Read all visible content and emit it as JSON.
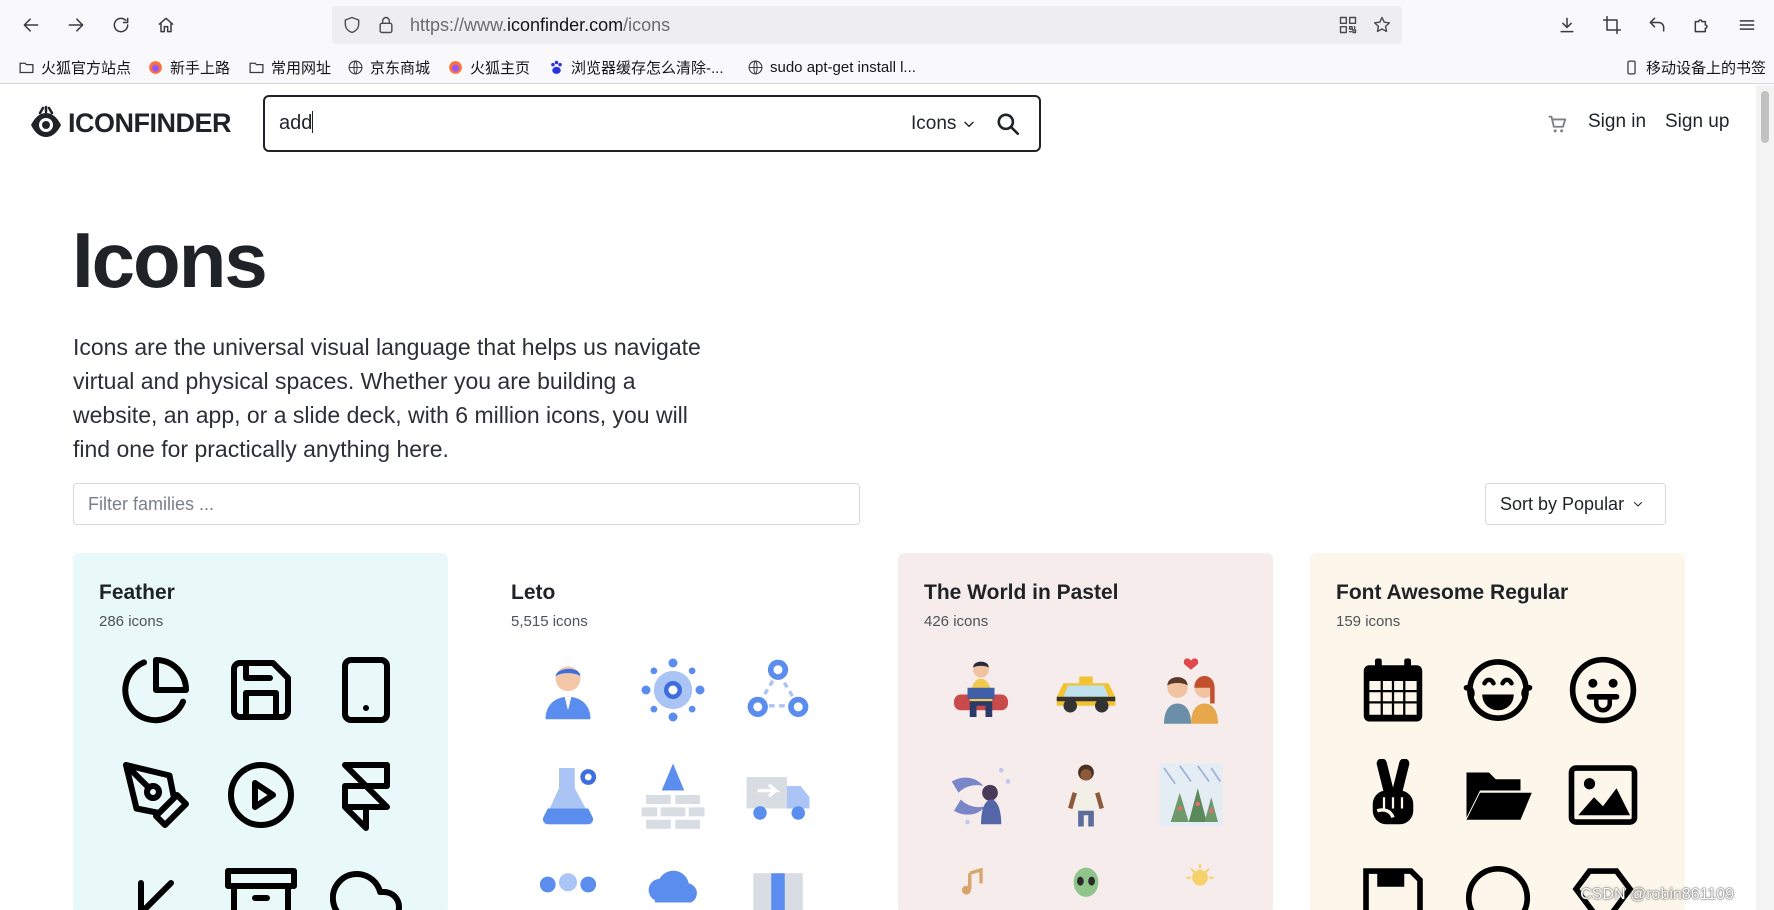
{
  "browser": {
    "url_prefix": "https://www.",
    "url_host": "iconfinder.com",
    "url_path": "/icons",
    "bookmarks": [
      {
        "label": "火狐官方站点",
        "icon": "folder-icon"
      },
      {
        "label": "新手上路",
        "icon": "firefox-icon"
      },
      {
        "label": "常用网址",
        "icon": "folder-icon"
      },
      {
        "label": "京东商城",
        "icon": "globe-icon"
      },
      {
        "label": "火狐主页",
        "icon": "firefox-icon"
      },
      {
        "label": "浏览器缓存怎么清除-...",
        "icon": "baidu-icon"
      },
      {
        "label": "sudo apt-get install l...",
        "icon": "globe-icon"
      }
    ],
    "mobile_bookmarks": "移动设备上的书签"
  },
  "header": {
    "logo_text": "ICONFINDER",
    "search_value": "add",
    "search_type": "Icons",
    "sign_in": "Sign in",
    "sign_up": "Sign up"
  },
  "hero": {
    "title": "Icons",
    "intro": "Icons are the universal visual language that helps us navigate virtual and physical spaces. Whether you are building a website, an app, or a slide deck, with 6 million icons, you will find one for practically anything here."
  },
  "controls": {
    "filter_placeholder": "Filter families ...",
    "sort_label": "Sort by Popular"
  },
  "families": [
    {
      "name": "Feather",
      "count": "286 icons",
      "bg": "#e9f8f9",
      "icons": [
        "pie-chart-icon",
        "save-icon",
        "tablet-icon",
        "pen-tool-icon",
        "play-circle-icon",
        "framer-icon",
        "arrow-down-left-icon",
        "archive-icon",
        "cloud-icon"
      ]
    },
    {
      "name": "Leto",
      "count": "5,515 icons",
      "bg": "#ffffff",
      "icons": [
        "user-icon",
        "settings-network-icon",
        "workflow-icon",
        "lab-flask-icon",
        "brick-wall-icon",
        "delivery-truck-icon",
        "team-icon",
        "cloud-icon",
        "package-icon"
      ]
    },
    {
      "name": "The World in Pastel",
      "count": "426 icons",
      "bg": "#f7ecec",
      "icons": [
        "person-reading-icon",
        "taxi-icon",
        "couple-icon",
        "dolphin-diver-icon",
        "woman-icon",
        "forest-rain-icon",
        "music-notes-icon",
        "alien-icon",
        "sun-icon"
      ]
    },
    {
      "name": "Font Awesome Regular",
      "count": "159 icons",
      "bg": "#fcf7ea",
      "icons": [
        "calendar-icon",
        "laughing-face-icon",
        "tongue-face-icon",
        "peace-hand-icon",
        "folder-open-icon",
        "image-icon",
        "save-icon",
        "smile-icon",
        "gem-icon"
      ]
    }
  ],
  "watermark": "CSDN @robin861109",
  "colors": {
    "feather_bg": "#e9f8f9",
    "pastel_bg": "#f7ecec",
    "fa_bg": "#fcf7ea",
    "leto_blue": "#5b8def"
  }
}
